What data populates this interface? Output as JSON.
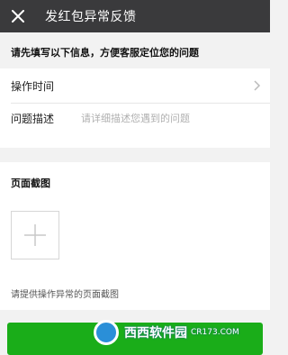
{
  "header": {
    "title": "发红包异常反馈",
    "close_icon": "close-icon"
  },
  "intro_text": "请先填写以下信息，方便客服定位您的问题",
  "form": {
    "time_label": "操作时间",
    "desc_label": "问题描述",
    "desc_placeholder": "请详细描述您遇到的问题"
  },
  "screenshot_section": {
    "title": "页面截图",
    "add_icon": "plus-icon",
    "hint": "请提供操作异常的页面截图"
  },
  "watermark": {
    "brand": "西西软件园",
    "url": "CR173.COM"
  },
  "colors": {
    "titlebar": "#3a3a3c",
    "submit": "#1aad19",
    "background": "#f2f2f2"
  }
}
